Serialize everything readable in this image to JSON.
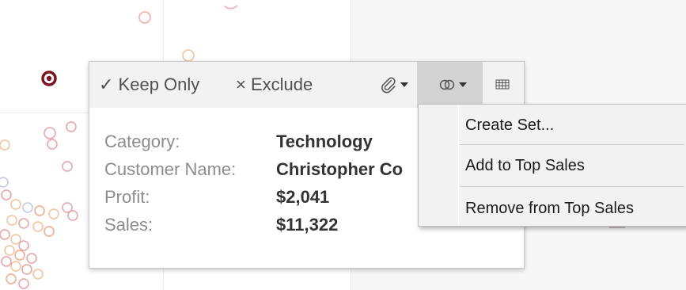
{
  "toolbar": {
    "keep_only": "✓ Keep Only",
    "exclude": "× Exclude",
    "icons": [
      "paperclip-icon",
      "group-members-icon",
      "view-data-icon"
    ]
  },
  "fields": [
    {
      "label": "Category:",
      "value": "Technology"
    },
    {
      "label": "Customer Name:",
      "value": "Christopher Co"
    },
    {
      "label": "Profit:",
      "value": "$2,041"
    },
    {
      "label": "Sales:",
      "value": "$11,322"
    }
  ],
  "menu": {
    "items": [
      "Create Set...",
      "Add to Top Sales",
      "Remove from Top Sales"
    ]
  },
  "colors": {
    "selected_mark": "#7a1420",
    "mark_palette": [
      "#e7a1a6",
      "#f2c197",
      "#bfc6e2",
      "#f4a88a"
    ]
  }
}
